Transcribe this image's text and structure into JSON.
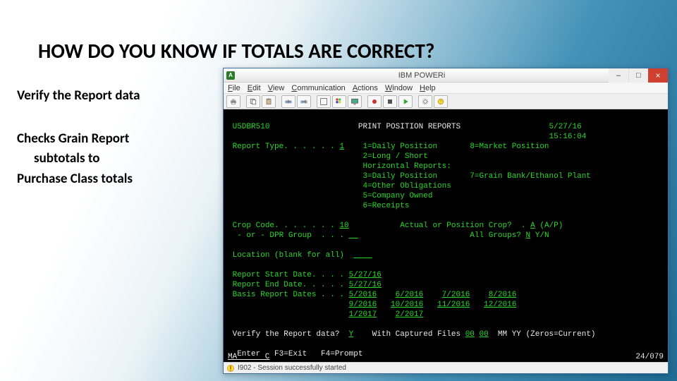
{
  "slide": {
    "title": "HOW DO YOU KNOW IF TOTALS ARE CORRECT?",
    "col": {
      "l1": "Verify the Report data",
      "l2": "Checks Grain Report",
      "l3": "subtotals to",
      "l4": "Purchase Class totals"
    }
  },
  "window": {
    "app_icon": "A",
    "title": "IBM POWERi",
    "buttons": {
      "min": "–",
      "max": "□",
      "close": "×"
    },
    "menu": [
      "File",
      "Edit",
      "View",
      "Communication",
      "Actions",
      "Window",
      "Help"
    ],
    "toolbar_icons": [
      "printer-icon",
      "copy-icon",
      "paste-icon",
      "send-icon",
      "receive-icon",
      "full-screen-icon",
      "color-map-icon",
      "display-icon",
      "record-icon",
      "stop-icon",
      "play-icon",
      "settings-icon",
      "help-icon"
    ],
    "statusbar": {
      "icon": "info-icon",
      "text": "I902 - Session successfully started"
    }
  },
  "screen": {
    "program": "U5DBR510",
    "title": "PRINT POSITION REPORTS",
    "date": "5/27/16",
    "time": "15:16:04",
    "report_type": {
      "label": "Report Type. . . . . .",
      "value": "1",
      "opts_col1": [
        "1=Daily Position",
        "2=Long / Short",
        "Horizontal Reports:",
        "3=Daily Position",
        "4=Other Obligations",
        "5=Company Owned",
        "6=Receipts"
      ],
      "opts_col2": [
        "8=Market Position",
        "",
        "",
        "7=Grain Bank/Ethanol Plant",
        "",
        "",
        ""
      ]
    },
    "crop": {
      "label1": "Crop Code. . . . . . .",
      "value1": "10",
      "label_right1": "Actual or Position Crop?  .",
      "value_right1": "A",
      "suffix_right1": "(A/P)",
      "label2": " - or - DPR Group  . . .",
      "value2": "",
      "label_right2": "All Groups?",
      "value_right2": "N",
      "suffix_right2": "Y/N"
    },
    "location": {
      "label": "Location (blank for all)",
      "value": "____"
    },
    "dates": {
      "start_l": "Report Start Date. . . .",
      "start_v": "5/27/16",
      "end_l": "Report End Date. . . . .",
      "end_v": "5/27/16",
      "basis_l": "Basis Report Dates . . .",
      "row1a": "5/2016",
      "row1b": "6/2016",
      "row1c": "7/2016",
      "row1d": "8/2016",
      "row2a": "9/2016",
      "row2b": "10/2016",
      "row2c": "11/2016",
      "row2d": "12/2016",
      "row3a": "1/2017",
      "row3b": "2/2017"
    },
    "verify": {
      "label": "Verify the Report data?",
      "value": "Y",
      "captured_l": "With Captured Files",
      "captured_v1": "00",
      "captured_v2": "00",
      "captured_suffix": "MM YY (Zeros=Current)"
    },
    "fkeys": "  Enter   F3=Exit   F4=Prompt",
    "bottom_left": "MA      C",
    "bottom_right": "24/079"
  }
}
